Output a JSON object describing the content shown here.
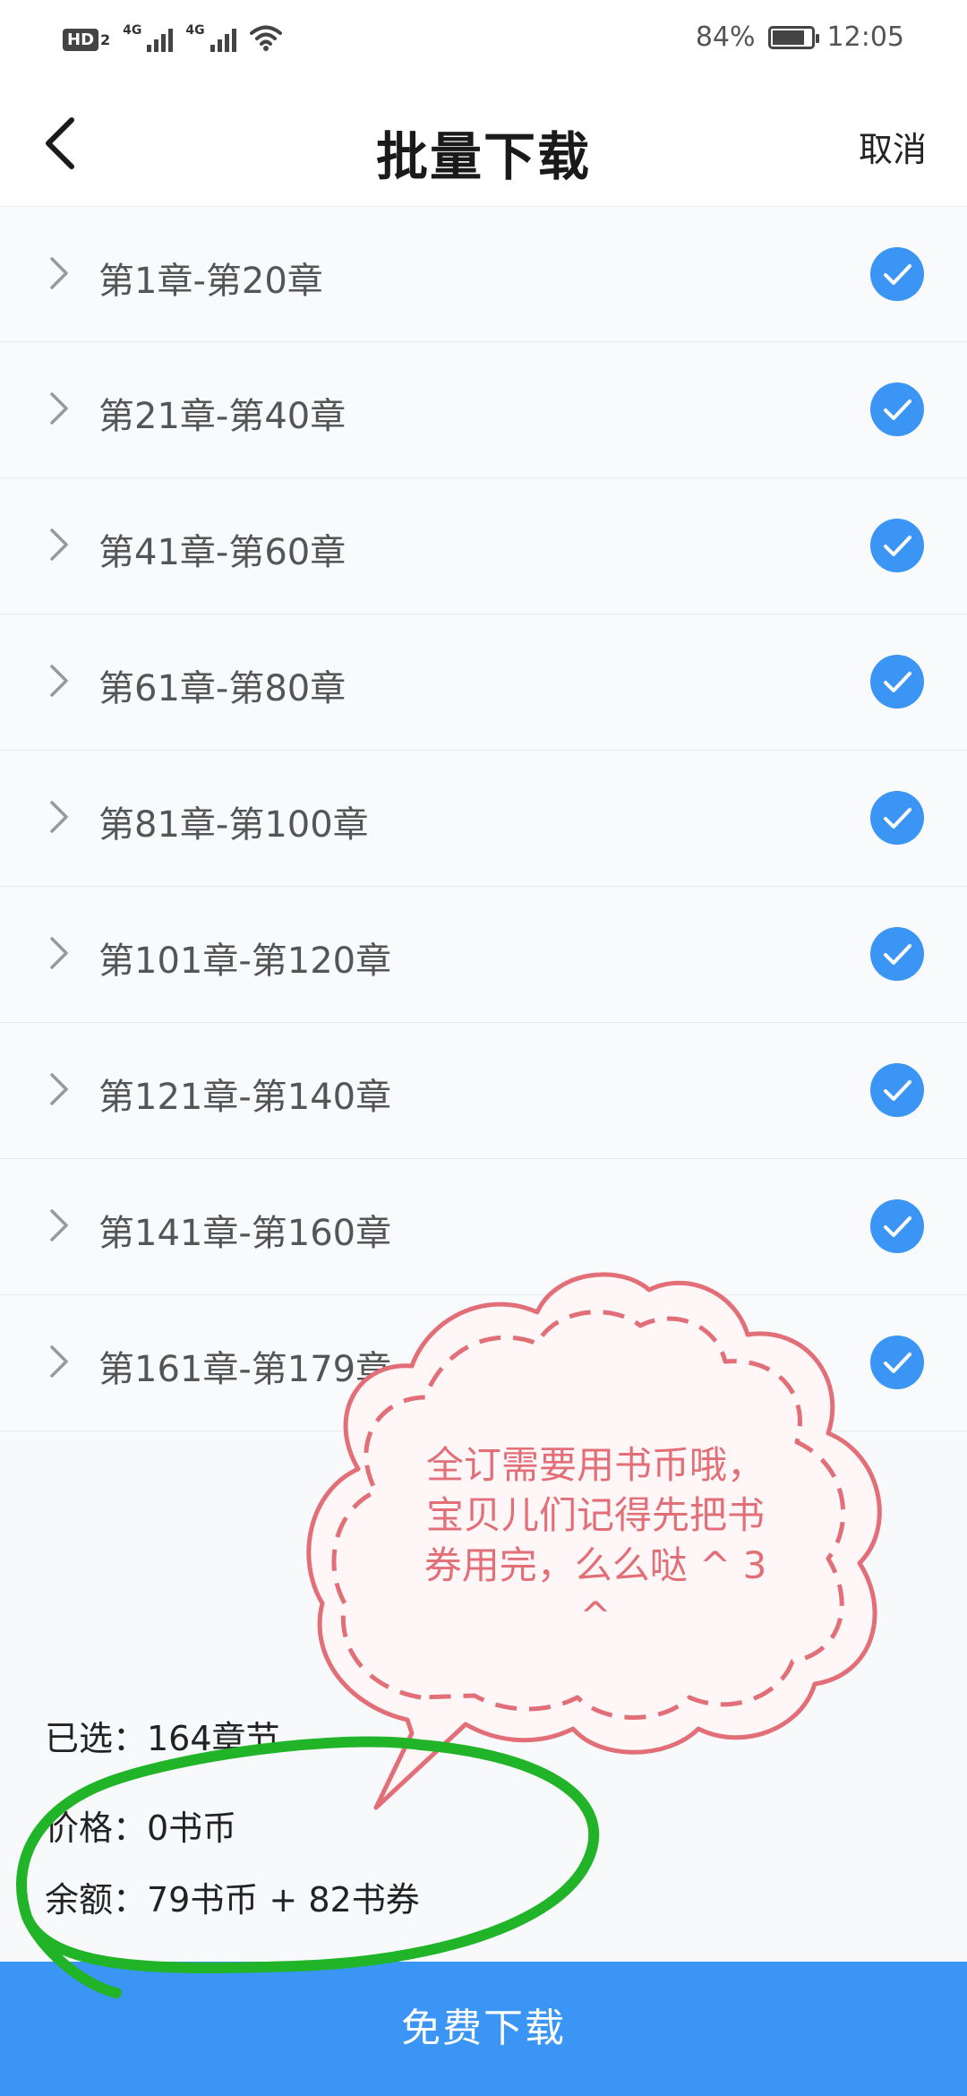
{
  "status_bar": {
    "hd_label": "HD",
    "hd_sub": "2",
    "net1_label": "4G",
    "net2_label": "4G",
    "battery_text": "84%",
    "battery_level": 0.84,
    "time": "12:05",
    "icons": [
      "hd-icon",
      "signal-icon",
      "signal-icon",
      "wifi-icon",
      "battery-icon"
    ]
  },
  "header": {
    "title": "批量下载",
    "cancel_label": "取消",
    "back_icon": "back-arrow-icon"
  },
  "chapters": [
    {
      "label": "第1章-第20章",
      "checked": true
    },
    {
      "label": "第21章-第40章",
      "checked": true
    },
    {
      "label": "第41章-第60章",
      "checked": true
    },
    {
      "label": "第61章-第80章",
      "checked": true
    },
    {
      "label": "第81章-第100章",
      "checked": true
    },
    {
      "label": "第101章-第120章",
      "checked": true
    },
    {
      "label": "第121章-第140章",
      "checked": true
    },
    {
      "label": "第141章-第160章",
      "checked": true
    },
    {
      "label": "第161章-第179章",
      "checked": true
    }
  ],
  "summary": {
    "selected": "已选：164章节",
    "price": "价格：0书币",
    "balance": "余额：79书币 + 82书券"
  },
  "download_label": "免费下载",
  "annotation": {
    "cloud_text": "全订需要用书币哦，宝贝儿们记得先把书券用完，么么哒 ^ 3 ^",
    "cloud_color": "#e26f78",
    "circle_color": "#22b428"
  },
  "colors": {
    "accent": "#3a95f4",
    "check": "#3a95f4"
  }
}
